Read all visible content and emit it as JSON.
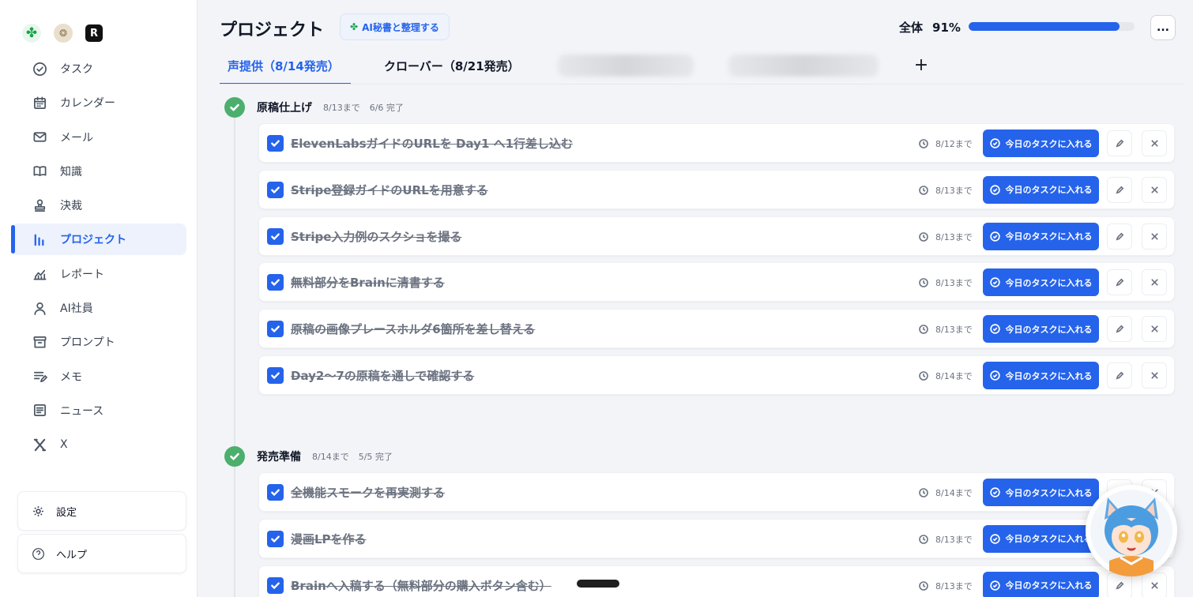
{
  "sidebar": {
    "logos": [
      "clover-logo",
      "badge-logo",
      "R"
    ],
    "items": [
      {
        "label": "タスク",
        "icon": "check-circle-icon"
      },
      {
        "label": "カレンダー",
        "icon": "calendar-icon"
      },
      {
        "label": "メール",
        "icon": "mail-icon"
      },
      {
        "label": "知識",
        "icon": "book-icon"
      },
      {
        "label": "決裁",
        "icon": "stamp-icon"
      },
      {
        "label": "プロジェクト",
        "icon": "bar-chart-icon",
        "active": true
      },
      {
        "label": "レポート",
        "icon": "line-chart-icon"
      },
      {
        "label": "AI社員",
        "icon": "user-icon"
      },
      {
        "label": "プロンプト",
        "icon": "archive-icon"
      },
      {
        "label": "メモ",
        "icon": "memo-icon"
      },
      {
        "label": "ニュース",
        "icon": "news-icon"
      },
      {
        "label": "X",
        "icon": "x-logo-icon"
      }
    ],
    "settings_label": "設定",
    "help_label": "ヘルプ"
  },
  "header": {
    "title": "プロジェクト",
    "ai_button": "AI秘書と整理する",
    "overall_label": "全体",
    "overall_percent": "91%",
    "progress": 0.91,
    "more_label": "..."
  },
  "tabs": [
    {
      "label": "声提供（8/14発売）",
      "active": true
    },
    {
      "label": "クローバー（8/21発売）",
      "active": false
    },
    {
      "label": "",
      "blurred": true
    },
    {
      "label": "",
      "blurred": true
    }
  ],
  "today_button_label": "今日のタスクに入れる",
  "sections": [
    {
      "title": "原稿仕上げ",
      "due": "8/13まで",
      "progress": "6/6 完了",
      "tasks": [
        {
          "title": "ElevenLabsガイドのURLを Day1 へ1行差し込む",
          "due": "8/12まで",
          "done": true
        },
        {
          "title": "Stripe登録ガイドのURLを用意する",
          "due": "8/13まで",
          "done": true
        },
        {
          "title": "Stripe入力例のスクショを撮る",
          "due": "8/13まで",
          "done": true
        },
        {
          "title": "無料部分をBrainに清書する",
          "due": "8/13まで",
          "done": true
        },
        {
          "title": "原稿の画像プレースホルダ6箇所を差し替える",
          "due": "8/13まで",
          "done": true
        },
        {
          "title": "Day2〜7の原稿を通しで確認する",
          "due": "8/14まで",
          "done": true
        }
      ]
    },
    {
      "title": "発売準備",
      "due": "8/14まで",
      "progress": "5/5 完了",
      "tasks": [
        {
          "title": "全機能スモークを再実測する",
          "due": "8/14まで",
          "done": true
        },
        {
          "title": "漫画LPを作る",
          "due": "8/13まで",
          "done": true
        },
        {
          "title": "Brainへ入稿する（無料部分の購入ボタン含む）",
          "due": "8/13まで",
          "done": true
        }
      ]
    }
  ],
  "colors": {
    "accent": "#2563eb",
    "success": "#4caf6d",
    "background": "#f3f4f8"
  }
}
